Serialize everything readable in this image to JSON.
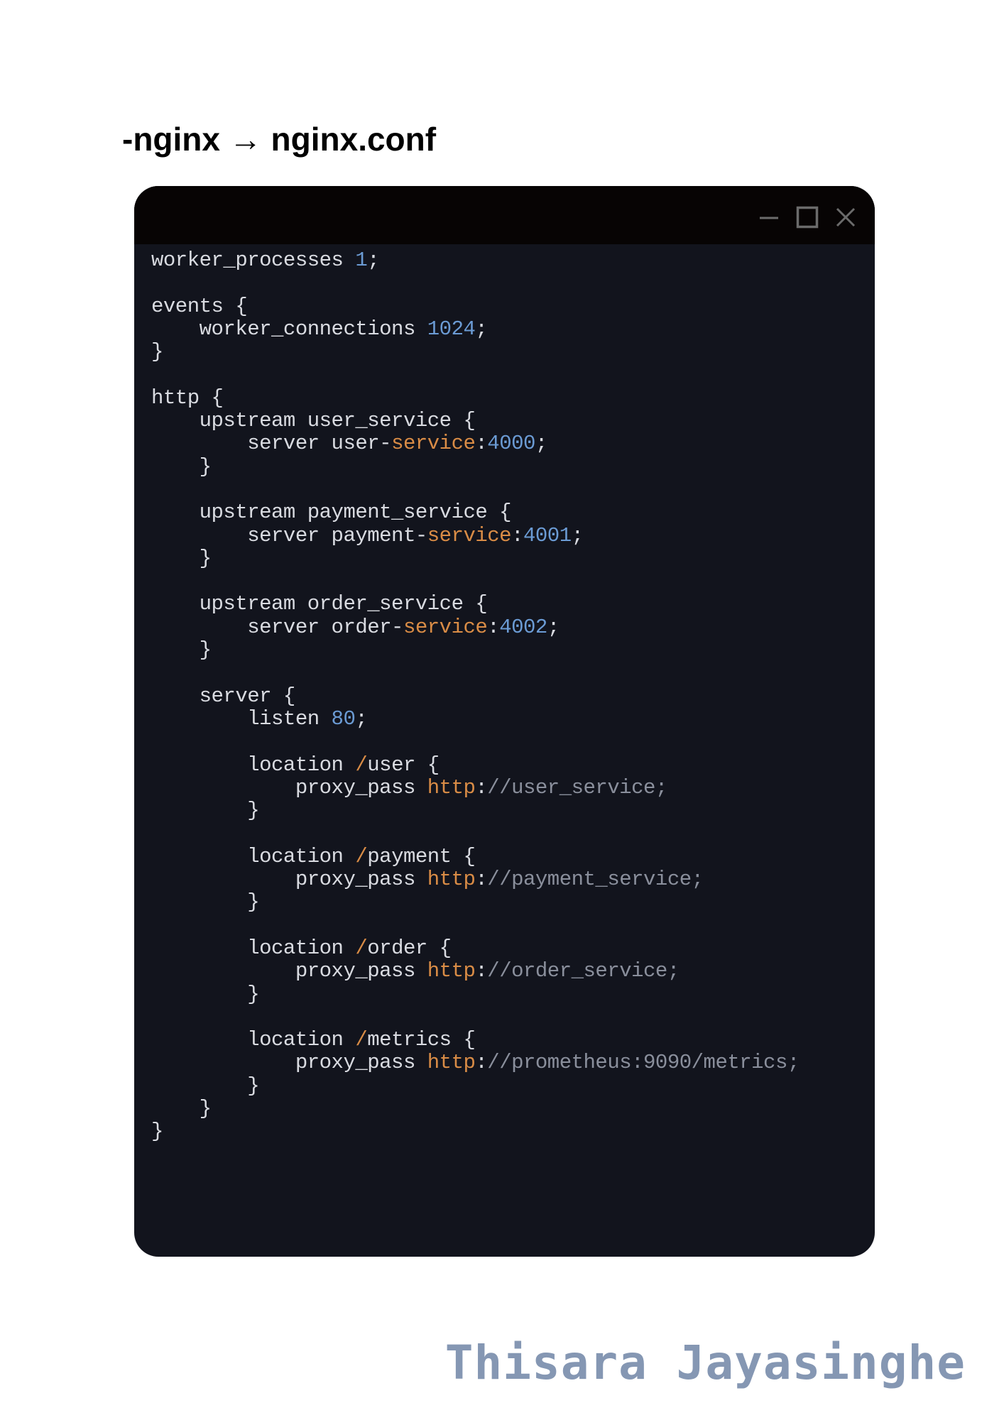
{
  "page": {
    "heading": "-nginx → nginx.conf",
    "author": "Thisara Jayasinghe"
  },
  "window": {
    "controls": [
      {
        "name": "minimize-icon"
      },
      {
        "name": "maximize-icon"
      },
      {
        "name": "close-icon"
      }
    ]
  },
  "colors": {
    "window_bg": "#12141d",
    "titlebar_bg": "#070404",
    "code_text": "#d9dbe1",
    "number": "#6b9bd4",
    "keyword": "#d98c46",
    "url": "#8a8f9c",
    "author": "#8597b3"
  },
  "code": {
    "lines": [
      [
        {
          "t": "worker_processes "
        },
        {
          "t": "1",
          "c": "num"
        },
        {
          "t": ";"
        }
      ],
      [],
      [
        {
          "t": "events {"
        }
      ],
      [
        {
          "t": "    worker_connections "
        },
        {
          "t": "1024",
          "c": "num"
        },
        {
          "t": ";"
        }
      ],
      [
        {
          "t": "}"
        }
      ],
      [],
      [
        {
          "t": "http {"
        }
      ],
      [
        {
          "t": "    upstream user_service {"
        }
      ],
      [
        {
          "t": "        server user-"
        },
        {
          "t": "service",
          "c": "kw"
        },
        {
          "t": ":"
        },
        {
          "t": "4000",
          "c": "num"
        },
        {
          "t": ";"
        }
      ],
      [
        {
          "t": "    }"
        }
      ],
      [],
      [
        {
          "t": "    upstream payment_service {"
        }
      ],
      [
        {
          "t": "        server payment-"
        },
        {
          "t": "service",
          "c": "kw"
        },
        {
          "t": ":"
        },
        {
          "t": "4001",
          "c": "num"
        },
        {
          "t": ";"
        }
      ],
      [
        {
          "t": "    }"
        }
      ],
      [],
      [
        {
          "t": "    upstream order_service {"
        }
      ],
      [
        {
          "t": "        server order-"
        },
        {
          "t": "service",
          "c": "kw"
        },
        {
          "t": ":"
        },
        {
          "t": "4002",
          "c": "num"
        },
        {
          "t": ";"
        }
      ],
      [
        {
          "t": "    }"
        }
      ],
      [],
      [
        {
          "t": "    server {"
        }
      ],
      [
        {
          "t": "        listen "
        },
        {
          "t": "80",
          "c": "num"
        },
        {
          "t": ";"
        }
      ],
      [],
      [
        {
          "t": "        location "
        },
        {
          "t": "/",
          "c": "slash"
        },
        {
          "t": "user {"
        }
      ],
      [
        {
          "t": "            proxy_pass "
        },
        {
          "t": "http",
          "c": "kw"
        },
        {
          "t": ":"
        },
        {
          "t": "//user_service;",
          "c": "path"
        }
      ],
      [
        {
          "t": "        }"
        }
      ],
      [],
      [
        {
          "t": "        location "
        },
        {
          "t": "/",
          "c": "slash"
        },
        {
          "t": "payment {"
        }
      ],
      [
        {
          "t": "            proxy_pass "
        },
        {
          "t": "http",
          "c": "kw"
        },
        {
          "t": ":"
        },
        {
          "t": "//payment_service;",
          "c": "path"
        }
      ],
      [
        {
          "t": "        }"
        }
      ],
      [],
      [
        {
          "t": "        location "
        },
        {
          "t": "/",
          "c": "slash"
        },
        {
          "t": "order {"
        }
      ],
      [
        {
          "t": "            proxy_pass "
        },
        {
          "t": "http",
          "c": "kw"
        },
        {
          "t": ":"
        },
        {
          "t": "//order_service;",
          "c": "path"
        }
      ],
      [
        {
          "t": "        }"
        }
      ],
      [],
      [
        {
          "t": "        location "
        },
        {
          "t": "/",
          "c": "slash"
        },
        {
          "t": "metrics {"
        }
      ],
      [
        {
          "t": "            proxy_pass "
        },
        {
          "t": "http",
          "c": "kw"
        },
        {
          "t": ":"
        },
        {
          "t": "//prometheus:9090/metrics;",
          "c": "path"
        }
      ],
      [
        {
          "t": "        }"
        }
      ],
      [
        {
          "t": "    }"
        }
      ],
      [
        {
          "t": "}"
        }
      ]
    ]
  }
}
